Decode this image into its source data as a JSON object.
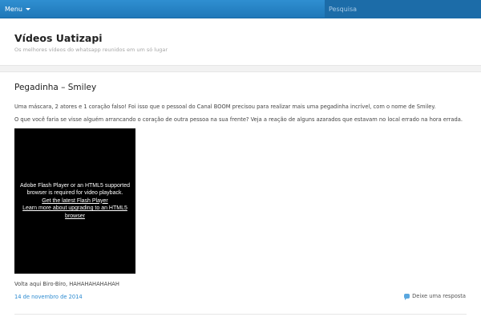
{
  "topbar": {
    "menu_label": "Menu",
    "search_placeholder": "Pesquisa"
  },
  "header": {
    "site_title": "Vídeos Uatizapi",
    "tagline": "Os melhores vídeos do whatsapp reunidos em um só lugar"
  },
  "post": {
    "title": "Pegadinha – Smiley",
    "paragraph1": "Uma máscara, 2 atores e 1 coração falso! Foi isso que o pessoal do Canal BOOM precisou para realizar mais uma pegadinha incrível, com o nome de Smiley.",
    "paragraph2": "O que você faria se visse alguém arrancando o coração de outra pessoa na sua frente? Veja a reação de alguns azarados que estavam no local errado na hora errada.",
    "video": {
      "message": "Adobe Flash Player or an HTML5 supported browser is required for video playback.",
      "link1": "Get the latest Flash Player",
      "link2": "Learn more about upgrading to an HTML5 browser"
    },
    "paragraph3": "Volta aqui Biro-Biro, HAHAHAHAHAHAH",
    "date": "14 de novembro de 2014",
    "reply_label": "Deixe uma resposta"
  },
  "colors": {
    "topbar": "#1f77b8",
    "link": "#2b8ad0",
    "background": "#f2f2f2"
  },
  "icons": {
    "menu": "chevron-down-icon",
    "reply": "comment-icon"
  }
}
